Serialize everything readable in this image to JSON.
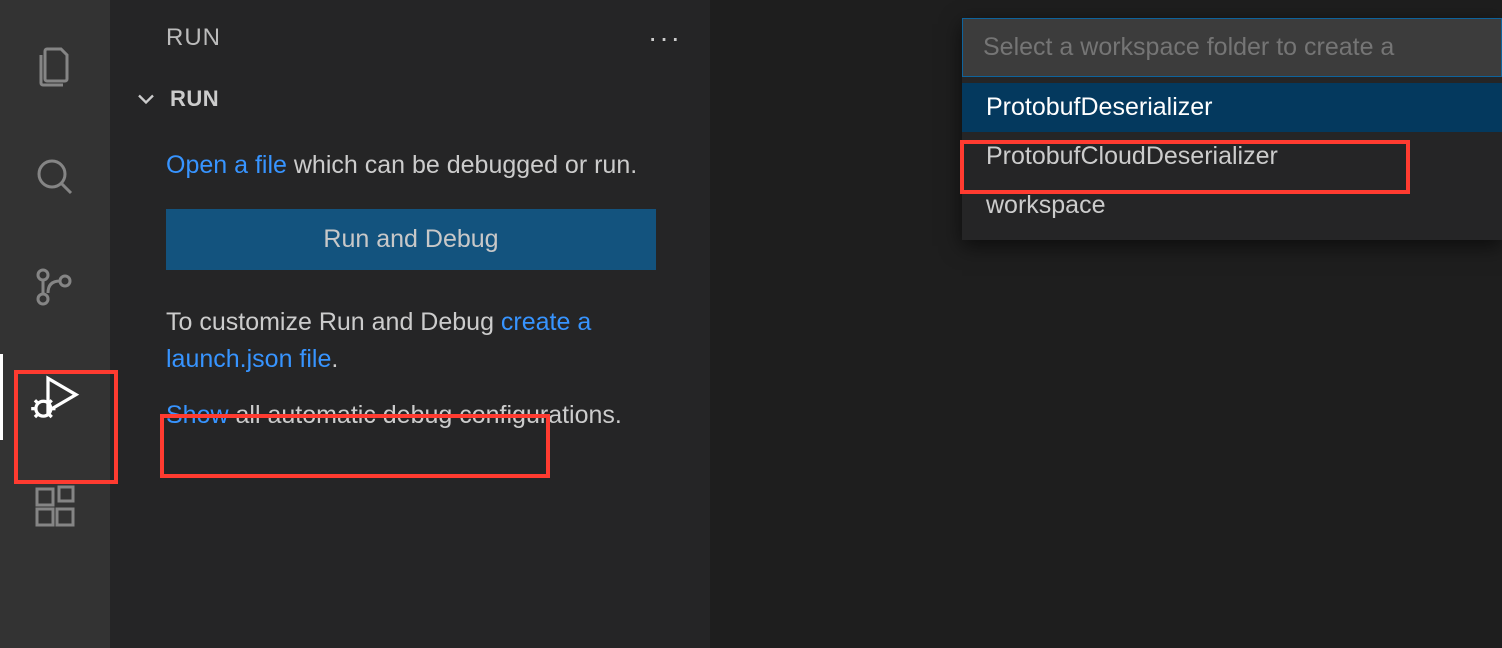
{
  "sidebar": {
    "title": "RUN",
    "section": "RUN",
    "para1_link": "Open a file",
    "para1_rest": " which can be debugged or run.",
    "run_debug_label": "Run and Debug",
    "para2_pre": "To customize Run and Debug ",
    "para2_link": "create a launch.json file",
    "para2_post": ".",
    "para3_link": "Show",
    "para3_rest": " all automatic debug configurations."
  },
  "quickpick": {
    "placeholder": "Select a workspace folder to create a",
    "items": [
      "ProtobufDeserializer",
      "ProtobufCloudDeserializer",
      "workspace"
    ]
  }
}
